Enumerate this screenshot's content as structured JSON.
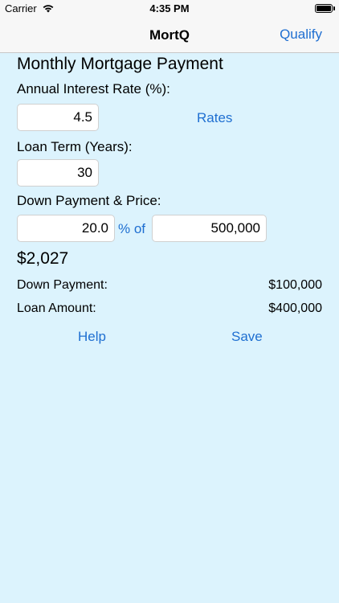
{
  "status_bar": {
    "carrier": "Carrier",
    "time": "4:35 PM"
  },
  "nav": {
    "title": "MortQ",
    "right_button": "Qualify"
  },
  "form": {
    "section_title": "Monthly Mortgage Payment",
    "interest_rate_label": "Annual Interest Rate (%):",
    "interest_rate_value": "4.5",
    "rates_link": "Rates",
    "loan_term_label": "Loan Term (Years):",
    "loan_term_value": "30",
    "down_payment_label": "Down Payment & Price:",
    "down_payment_percent": "20.0",
    "percent_of_text": "% of",
    "price_value": "500,000"
  },
  "results": {
    "monthly_payment": "$2,027",
    "down_payment_label": "Down Payment:",
    "down_payment_value": "$100,000",
    "loan_amount_label": "Loan Amount:",
    "loan_amount_value": "$400,000"
  },
  "actions": {
    "help": "Help",
    "save": "Save"
  },
  "colors": {
    "background": "#dcf3fd",
    "link": "#1f6fd1",
    "bar": "#f7f7f7"
  }
}
